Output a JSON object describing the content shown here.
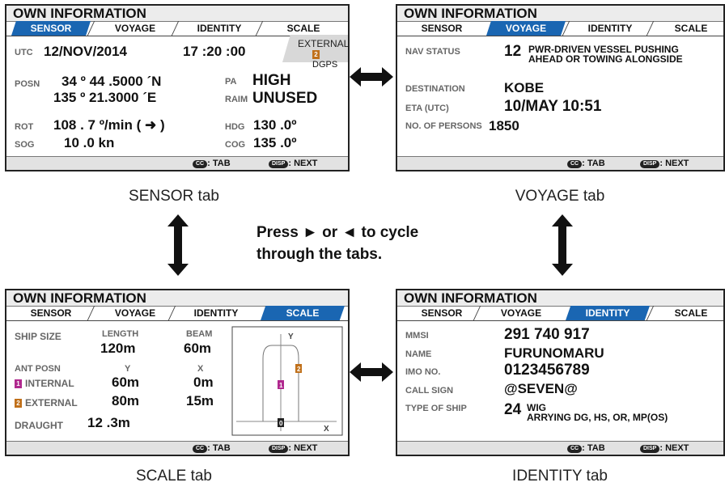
{
  "common": {
    "title": "OWN INFORMATION",
    "tabs": [
      "SENSOR",
      "VOYAGE",
      "IDENTITY",
      "SCALE"
    ],
    "footer_tab": ": TAB",
    "footer_next": ": NEXT",
    "cc_glyph": "CC",
    "disp_glyph": "DISP"
  },
  "sensor": {
    "caption": "SENSOR tab",
    "utc_label": "UTC",
    "utc_date": "12/NOV/2014",
    "utc_time": "17 :20 :00",
    "ext_label": "EXTERNAL",
    "ext_badge": "2",
    "ext_src": "DGPS",
    "posn_label": "POSN",
    "lat": "34 º 44 .5000 ´N",
    "lon": "135 º 21.3000 ´E",
    "pa_label": "PA",
    "pa_value": "HIGH",
    "raim_label": "RAIM",
    "raim_value": "UNUSED",
    "rot_label": "ROT",
    "rot_value": "108 . 7 º/min ( ➜ )",
    "hdg_label": "HDG",
    "hdg_value": "130 .0º",
    "sog_label": "SOG",
    "sog_value": "10 .0 kn",
    "cog_label": "COG",
    "cog_value": "135 .0º"
  },
  "voyage": {
    "caption": "VOYAGE tab",
    "nav_label": "NAV STATUS",
    "nav_code": "12",
    "nav_text1": "PWR-DRIVEN VESSEL PUSHING",
    "nav_text2": "AHEAD OR TOWING ALONGSIDE",
    "dest_label": "DESTINATION",
    "dest_value": "KOBE",
    "eta_label": "ETA (UTC)",
    "eta_value": "10/MAY 10:51",
    "persons_label": "NO. OF PERSONS",
    "persons_value": "1850"
  },
  "scale": {
    "caption": "SCALE tab",
    "ship_size_label": "SHIP SIZE",
    "length_label": "LENGTH",
    "length_value": "120m",
    "beam_label": "BEAM",
    "beam_value": "60m",
    "ant_label": "ANT POSN",
    "y_label": "Y",
    "x_label": "X",
    "internal_badge": "1",
    "internal_label": "INTERNAL",
    "internal_y": "60m",
    "internal_x": "0m",
    "external_badge": "2",
    "external_label": "EXTERNAL",
    "external_y": "80m",
    "external_x": "15m",
    "draught_label": "DRAUGHT",
    "draught_value": "12 .3m",
    "diag_y": "Y",
    "diag_x": "X",
    "diag_origin": "0",
    "diag_1": "1",
    "diag_2": "2"
  },
  "identity": {
    "caption": "IDENTITY tab",
    "mmsi_label": "MMSI",
    "mmsi_value": "291 740 917",
    "name_label": "NAME",
    "name_value": "FURUNOMARU",
    "imo_label": "IMO NO.",
    "imo_value": "0123456789",
    "call_label": "CALL SIGN",
    "call_value": "@SEVEN@",
    "type_label": "TYPE OF SHIP",
    "type_code": "24",
    "type_text1": "WIG",
    "type_text2": "ARRYING DG, HS, OR, MP(OS)"
  },
  "middle_text": {
    "line1": "Press ► or ◄ to cycle",
    "line2": "through the tabs."
  },
  "colors": {
    "active_tab": "#1a66b2",
    "badge_internal": "#b0288e",
    "badge_external": "#c0701a"
  }
}
